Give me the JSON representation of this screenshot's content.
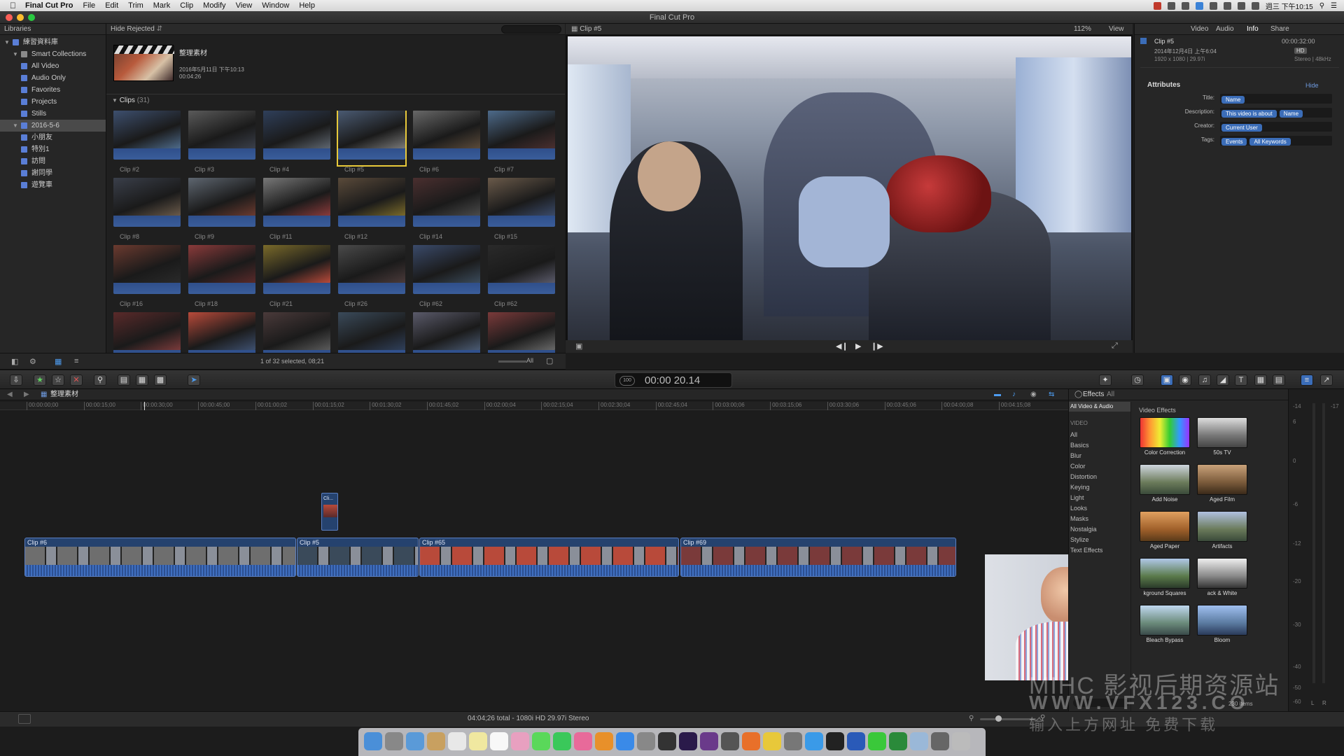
{
  "menubar": {
    "app": "Final Cut Pro",
    "items": [
      "File",
      "Edit",
      "Trim",
      "Mark",
      "Clip",
      "Modify",
      "View",
      "Window",
      "Help"
    ],
    "clock": "週三 下午10:15"
  },
  "window": {
    "title": "Final Cut Pro"
  },
  "libraries": {
    "header": "Libraries",
    "items": [
      {
        "label": "練習資料庫",
        "level": 0
      },
      {
        "label": "Smart Collections",
        "level": 1
      },
      {
        "label": "All Video",
        "level": 2
      },
      {
        "label": "Audio Only",
        "level": 2
      },
      {
        "label": "Favorites",
        "level": 2
      },
      {
        "label": "Projects",
        "level": 2
      },
      {
        "label": "Stills",
        "level": 2
      },
      {
        "label": "2016-5-6",
        "level": 1
      },
      {
        "label": "小朋友",
        "level": 2
      },
      {
        "label": "特別1",
        "level": 2
      },
      {
        "label": "訪問",
        "level": 2
      },
      {
        "label": "謝同學",
        "level": 2
      },
      {
        "label": "遊覽車",
        "level": 2
      }
    ]
  },
  "browser": {
    "filter": "Hide Rejected",
    "project": {
      "name": "整理素材",
      "date": "2016年5月11日 下午10:13",
      "duration": "00:04:26"
    },
    "section": "Clips",
    "count": "(31)",
    "clips": [
      "Clip #2",
      "Clip #3",
      "Clip #4",
      "Clip #5",
      "Clip #6",
      "Clip #7",
      "Clip #8",
      "Clip #9",
      "Clip #11",
      "Clip #12",
      "Clip #14",
      "Clip #15",
      "Clip #16",
      "Clip #18",
      "Clip #21",
      "Clip #26",
      "Clip #62",
      "Clip #62",
      "",
      "",
      "",
      "",
      "",
      ""
    ],
    "selection": "1 of 32 selected, 08;21",
    "all_label": "All"
  },
  "viewer": {
    "clip": "Clip #5",
    "zoom": "112%",
    "view_label": "View"
  },
  "inspector": {
    "tabs": [
      "Video",
      "Audio",
      "Info",
      "Share"
    ],
    "clip_name": "Clip #5",
    "timecode": "00:00:32:00",
    "date": "2014年12月4日 上午6:04",
    "format": "1920 x 1080 | 29.97i",
    "audio": "Stereo | 48kHz",
    "hd_badge": "HD",
    "section": "Attributes",
    "hide": "Hide",
    "rows": [
      {
        "label": "Title:",
        "values": [
          "Name"
        ]
      },
      {
        "label": "Description:",
        "values": [
          "This video is about",
          "Name"
        ]
      },
      {
        "label": "Creator:",
        "values": [
          "Current User"
        ]
      },
      {
        "label": "Tags:",
        "values": [
          "Events",
          "All Keywords"
        ]
      }
    ]
  },
  "toolbar": {
    "timecode": "00:00 20.14",
    "timecode_badge": "100"
  },
  "timeline": {
    "project": "整理素材",
    "ruler": [
      "00:00:00;00",
      "00:00:15;00",
      "00:00:30;00",
      "00:00:45;00",
      "00:01:00;02",
      "00:01:15;02",
      "00:01:30;02",
      "00:01:45;02",
      "00:02:00;04",
      "00:02:15;04",
      "00:02:30;04",
      "00:02:45;04",
      "00:03:00;06",
      "00:03:15;06",
      "00:03:30;06",
      "00:03:45;06",
      "00:04:00;08",
      "00:04:15;08"
    ],
    "clips": [
      {
        "name": "Clip #6"
      },
      {
        "name": "Clip #5"
      },
      {
        "name": "Clip #65"
      },
      {
        "name": "Clip #69"
      }
    ],
    "connected": "Cli..."
  },
  "effects": {
    "title": "Effects",
    "filter": "All",
    "selected_category": "All Video & Audio",
    "video_heading": "VIDEO",
    "categories": [
      "All",
      "Basics",
      "Blur",
      "Color",
      "Distortion",
      "Keying",
      "Light",
      "Looks",
      "Masks",
      "Nostalgia",
      "Stylize",
      "Text Effects"
    ],
    "grid_heading": "Video Effects",
    "items": [
      "Color Correction",
      "50s TV",
      "Add Noise",
      "Aged Film",
      "Aged Paper",
      "Artifacts",
      "kground Squares",
      "ack & White",
      "Bleach Bypass",
      "Bloom"
    ],
    "count": "230 items"
  },
  "meters": {
    "labels": [
      "-14",
      "-17",
      "6",
      "0",
      "-6",
      "-12",
      "-20",
      "-30",
      "-40",
      "-50",
      "-60"
    ],
    "lr": [
      "L",
      "R"
    ]
  },
  "statusbar": {
    "text": "04:04;26 total - 1080i HD 29.97i Stereo"
  },
  "watermark": {
    "line1": "MIHC 影视后期资源站",
    "line2": "WWW.VFX123.CO",
    "line3": "输入上方网址 免费下载"
  },
  "colors": {
    "accent": "#3b6db8",
    "clip_blue": "#25426e",
    "selection_yellow": "#e8c93a"
  }
}
